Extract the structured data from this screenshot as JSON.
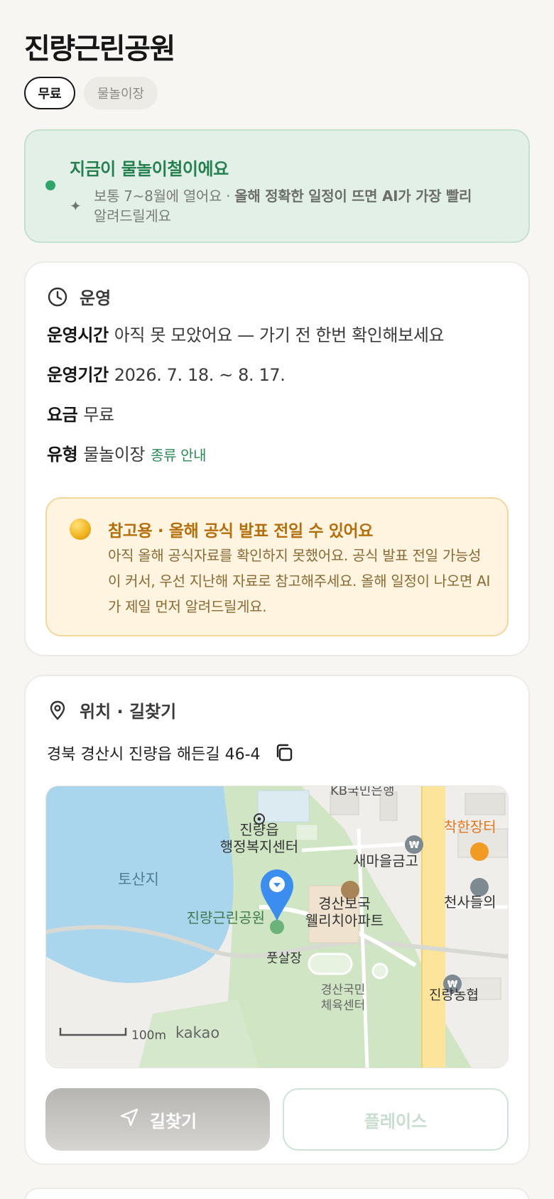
{
  "page": {
    "title": "진량근린공원"
  },
  "chips": {
    "fee": "무료",
    "type": "물놀이장"
  },
  "season_banner": {
    "title": "지금이 물놀이철이에요",
    "desc_plain": "보통 7~8월에 열어요 · ",
    "desc_bold": "올해 정확한 일정이 뜨면 AI가 가장 빨리",
    "desc_tail": "알려드릴게요"
  },
  "operations": {
    "heading": "운영",
    "hours_key": "운영시간",
    "hours_value": "아직 못 모았어요 — 가기 전 한번 확인해보세요",
    "period_key": "운영기간",
    "period_value": "2026. 7. 18. ~ 8. 17.",
    "fee_key": "요금",
    "fee_value": "무료",
    "type_key": "유형",
    "type_value": "물놀이장",
    "type_link": "종류 안내",
    "notice_title": "참고용 · 올해 공식 발표 전일 수 있어요",
    "notice_body": "아직 올해 공식자료를 확인하지 못했어요. 공식 발표 전일 가능성이 커서, 우선 지난해 자료로 참고해주세요. 올해 일정이 나오면 AI가 제일 먼저 알려드릴게요."
  },
  "location": {
    "heading": "위치 · 길찾기",
    "address": "경북 경산시 진량읍 해든길 46-4",
    "map": {
      "labels": {
        "lake": "토산지",
        "center_1": "진량읍",
        "center_2": "행정복지센터",
        "bank": "새마을금고",
        "store": "착한장터",
        "church": "천사들의",
        "apt_1": "경산보국",
        "apt_2": "웰리치아파트",
        "park": "진량근린공원",
        "futsal": "풋살장",
        "sports_1": "경산국민",
        "sports_2": "체육센터",
        "nonghyup": "진량농협",
        "kb": "KB국민은행",
        "scale": "100m",
        "brand": "kakao"
      }
    },
    "nav_button": "길찾기",
    "place_button": "플레이스"
  },
  "colors": {
    "accent_green": "#2fa56a",
    "notice_orange": "#b66e0a",
    "map_pin": "#2f8cf0"
  }
}
